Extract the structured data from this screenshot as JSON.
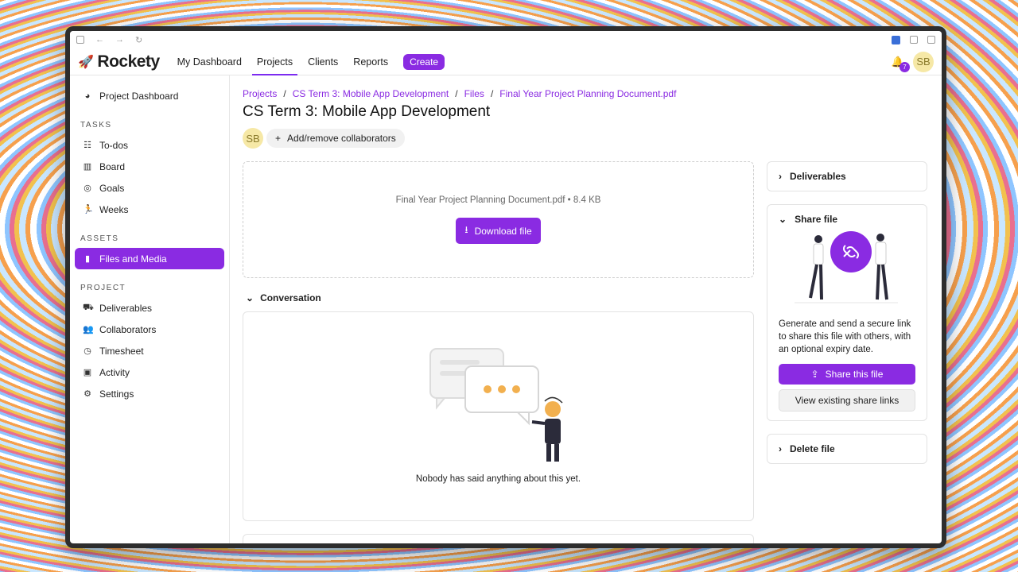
{
  "header": {
    "brand": "Rockety",
    "nav": [
      "My Dashboard",
      "Projects",
      "Clients",
      "Reports"
    ],
    "active_nav": "Projects",
    "create_label": "Create",
    "notification_count": "7",
    "user_initials": "SB"
  },
  "sidebar": {
    "top_item": "Project Dashboard",
    "sections": {
      "tasks_title": "TASKS",
      "tasks": [
        "To-dos",
        "Board",
        "Goals",
        "Weeks"
      ],
      "assets_title": "ASSETS",
      "assets": [
        "Files and Media"
      ],
      "project_title": "PROJECT",
      "project": [
        "Deliverables",
        "Collaborators",
        "Timesheet",
        "Activity",
        "Settings"
      ]
    },
    "active_item": "Files and Media"
  },
  "breadcrumbs": [
    "Projects",
    "CS Term 3: Mobile App Development",
    "Files",
    "Final Year Project Planning Document.pdf"
  ],
  "page_title": "CS Term 3: Mobile App Development",
  "collaborators": {
    "avatar_initials": "SB",
    "button_label": "Add/remove collaborators"
  },
  "file": {
    "name": "Final Year Project Planning Document.pdf",
    "separator": "•",
    "size": "8.4 KB",
    "download_label": "Download file"
  },
  "conversation": {
    "title": "Conversation",
    "empty_text": "Nobody has said anything about this yet."
  },
  "panels": {
    "deliverables_title": "Deliverables",
    "share_title": "Share file",
    "share_description": "Generate and send a secure link to share this file with others, with an optional expiry date.",
    "share_button": "Share this file",
    "view_links_button": "View existing share links",
    "delete_title": "Delete file"
  },
  "colors": {
    "accent": "#8a2be2"
  }
}
